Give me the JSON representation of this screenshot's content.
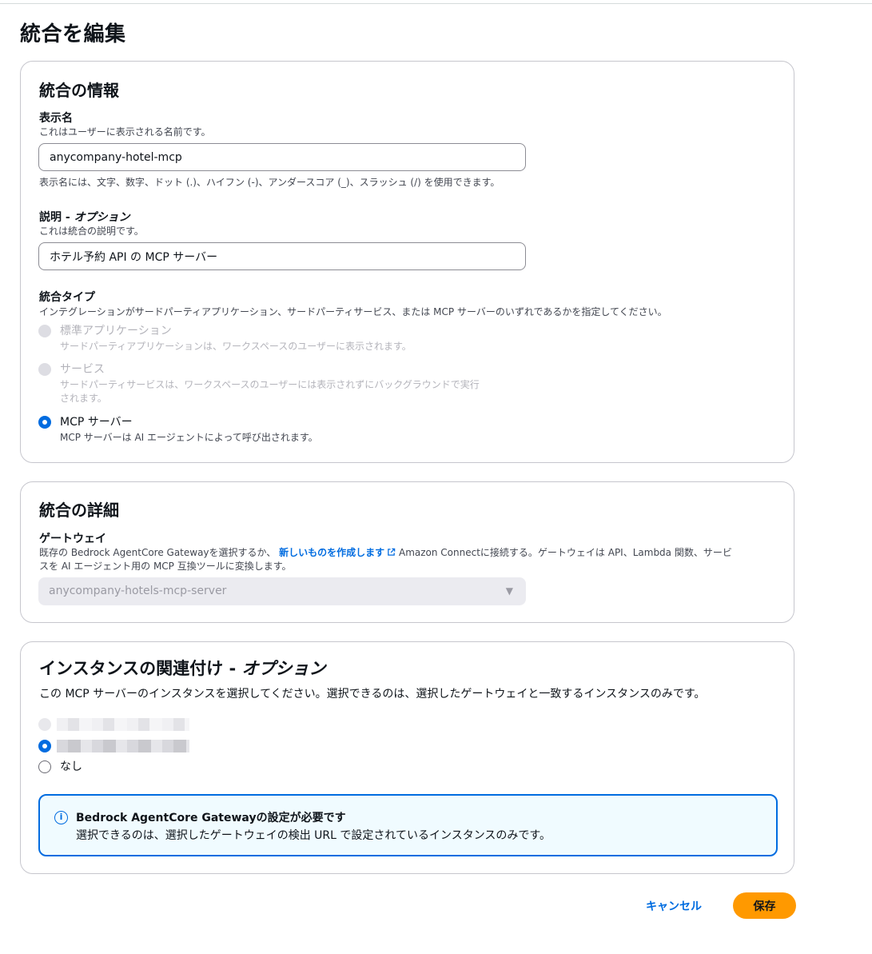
{
  "page": {
    "title": "統合を編集"
  },
  "info_section": {
    "title": "統合の情報",
    "display_name": {
      "label": "表示名",
      "description": "これはユーザーに表示される名前です。",
      "value": "anycompany-hotel-mcp",
      "constraint": "表示名には、文字、数字、ドット (.)、ハイフン (-)、アンダースコア (_)、スラッシュ (/) を使用できます。"
    },
    "description_field": {
      "label": "説明 - ",
      "label_optional": "オプション",
      "description": "これは統合の説明です。",
      "value": "ホテル予約 API の MCP サーバー"
    },
    "integration_type": {
      "label": "統合タイプ",
      "description": "インテグレーションがサードパーティアプリケーション、サードパーティサービス、または MCP サーバーのいずれであるかを指定してください。",
      "options": [
        {
          "label": "標準アプリケーション",
          "description": "サードパーティアプリケーションは、ワークスペースのユーザーに表示されます。",
          "state": "disabled"
        },
        {
          "label": "サービス",
          "description_line1": "サードパーティサービスは、ワークスペースのユーザーには表示されずにバックグラウンドで実行",
          "description_line2": "されます。",
          "state": "disabled"
        },
        {
          "label": "MCP サーバー",
          "description": "MCP サーバーは AI エージェントによって呼び出されます。",
          "state": "checked"
        }
      ]
    }
  },
  "details_section": {
    "title": "統合の詳細",
    "gateway": {
      "label": "ゲートウェイ",
      "description_prefix": "既存の Bedrock AgentCore Gatewayを選択するか、",
      "link_text": "新しいものを作成します",
      "description_suffix": "Amazon Connectに接続する。ゲートウェイは API、Lambda 関数、サービ",
      "description_line2": "スを AI エージェント用の MCP 互換ツールに変換します。",
      "selected_value": "anycompany-hotels-mcp-server"
    }
  },
  "instance_section": {
    "title_prefix": "インスタンスの関連付け - ",
    "title_optional": "オプション",
    "description": "この MCP サーバーのインスタンスを選択してください。選択できるのは、選択したゲートウェイと一致するインスタンスのみです。",
    "none_label": "なし",
    "alert": {
      "title": "Bedrock AgentCore Gatewayの設定が必要です",
      "body": "選択できるのは、選択したゲートウェイの検出 URL で設定されているインスタンスのみです。"
    }
  },
  "actions": {
    "cancel_label": "キャンセル",
    "save_label": "保存"
  },
  "colors": {
    "accent": "#006ce0",
    "primary_button": "#ff9900",
    "alert_bg": "#f0fbff"
  },
  "icons": [
    "external-link-icon",
    "dropdown-caret-icon",
    "info-icon"
  ]
}
